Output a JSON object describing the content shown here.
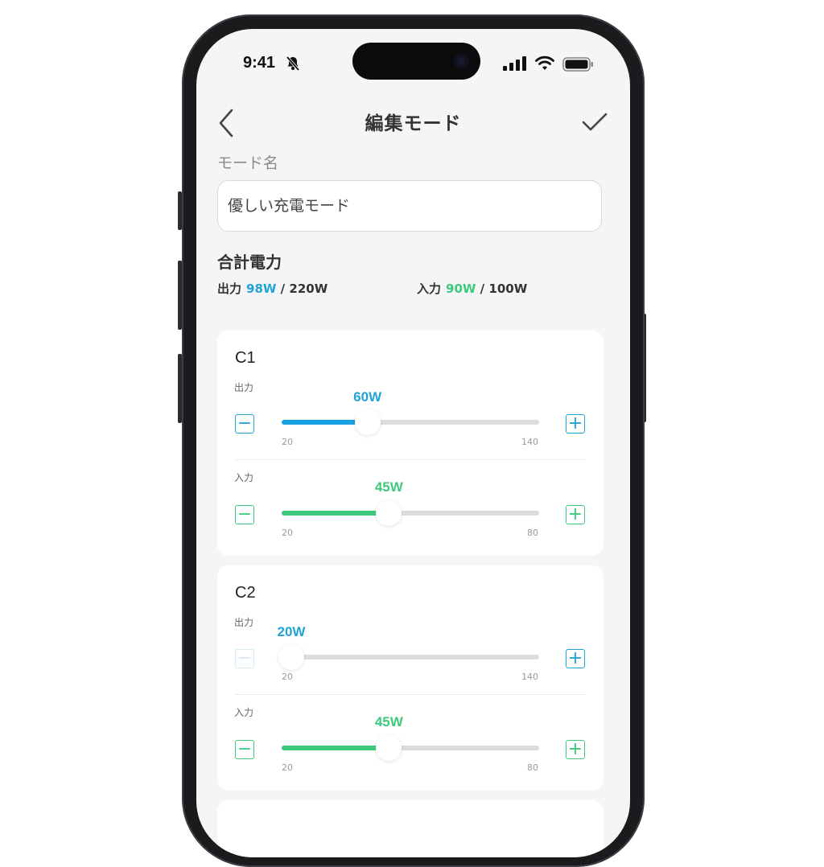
{
  "status": {
    "time": "9:41"
  },
  "header": {
    "title": "編集モード"
  },
  "mode": {
    "label": "モード名",
    "value": "優しい充電モード"
  },
  "total": {
    "title": "合計電力",
    "output_label": "出力",
    "output_value": "98W",
    "output_sep": "/",
    "output_max": "220W",
    "input_label": "入力",
    "input_value": "90W",
    "input_sep": "/",
    "input_max": "100W"
  },
  "ports": [
    {
      "name": "C1",
      "output": {
        "label": "出力",
        "value_text": "60W",
        "value": 60,
        "min": 20,
        "max": 140,
        "min_label": "20",
        "max_label": "140"
      },
      "input": {
        "label": "入力",
        "value_text": "45W",
        "value": 45,
        "min": 20,
        "max": 80,
        "min_label": "20",
        "max_label": "80"
      }
    },
    {
      "name": "C2",
      "output": {
        "label": "出力",
        "value_text": "20W",
        "value": 20,
        "min": 20,
        "max": 140,
        "min_label": "20",
        "max_label": "140"
      },
      "input": {
        "label": "入力",
        "value_text": "45W",
        "value": 45,
        "min": 20,
        "max": 80,
        "min_label": "20",
        "max_label": "80"
      }
    }
  ],
  "buttons": {
    "minus": "−",
    "plus": "+"
  },
  "colors": {
    "output_accent": "#1fa3d9",
    "input_accent": "#3ec97c",
    "background": "#f5f4f7"
  },
  "icons": [
    "back-icon",
    "check-icon",
    "bell-slash-icon",
    "signal-icon",
    "wifi-icon",
    "battery-icon"
  ]
}
